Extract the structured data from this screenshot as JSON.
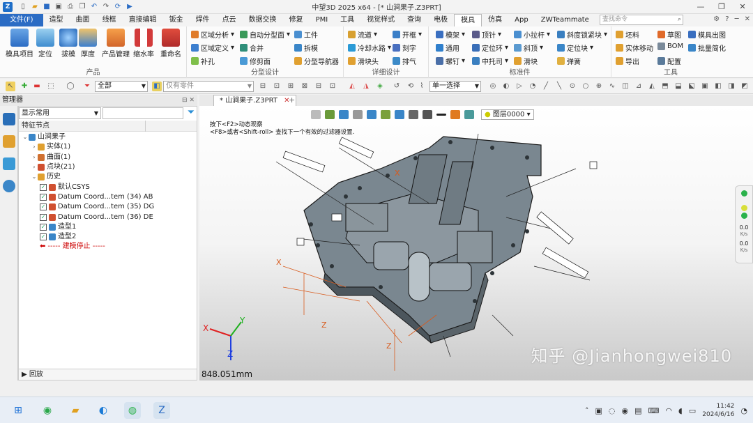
{
  "title_bar": {
    "title": "中望3D 2025 x64 - [* 山涧果子.Z3PRT]",
    "qat_icons": [
      "new-file-icon",
      "open-folder-icon",
      "save-icon",
      "save-all-icon",
      "print-icon",
      "copy-icon",
      "undo-icon",
      "redo-icon",
      "regen-icon",
      "play-icon"
    ]
  },
  "menu": {
    "file_label": "文件(F)",
    "tabs": [
      "造型",
      "曲面",
      "线框",
      "直接编辑",
      "钣金",
      "焊件",
      "点云",
      "数据交换",
      "修复",
      "PMI",
      "工具",
      "视觉样式",
      "查询",
      "电极",
      "模具",
      "仿真",
      "App",
      "ZWTeammate"
    ],
    "active_tab": "模具",
    "search_placeholder": "查找命令"
  },
  "ribbon": {
    "product": {
      "label": "产品",
      "buttons": [
        "模具项目",
        "定位",
        "拔模",
        "厚度",
        "产品管理",
        "缩水率",
        "重命名"
      ]
    },
    "parting": {
      "label": "分型设计",
      "buttons": [
        "区域分析",
        "自动分型面",
        "工件",
        "区域定义",
        "合并",
        "拆模",
        "补孔",
        "修剪面",
        "分型导航器"
      ]
    },
    "detail": {
      "label": "详细设计",
      "buttons": [
        "流道",
        "开框",
        "冷却水路",
        "刻字",
        "滑块头",
        "排气"
      ]
    },
    "standard": {
      "label": "标准件",
      "buttons": [
        "模架",
        "顶针",
        "小拉杆",
        "斜度锁紧块",
        "通用",
        "定位环",
        "斜顶",
        "定位块",
        "螺钉",
        "中托司",
        "滑块",
        "弹簧"
      ]
    },
    "tools": {
      "label": "工具",
      "buttons": [
        "坯料",
        "草图",
        "模具出图",
        "实体移动",
        "BOM",
        "批量简化",
        "导出",
        "配置"
      ]
    }
  },
  "toolbar": {
    "filter_all": "全部",
    "filter_parts": "仅有零件",
    "select_mode": "单一选择"
  },
  "manager": {
    "title": "管理器",
    "filter_value": "显示常用",
    "column_header": "特征节点",
    "tree": [
      {
        "label": "山涧果子",
        "indent": 0,
        "toggle": "⌄",
        "icon": "part"
      },
      {
        "label": "实体(1)",
        "indent": 1,
        "toggle": "›",
        "icon": "solid"
      },
      {
        "label": "曲面(1)",
        "indent": 1,
        "toggle": "›",
        "icon": "surface"
      },
      {
        "label": "点块(21)",
        "indent": 1,
        "toggle": "›",
        "icon": "point"
      },
      {
        "label": "历史",
        "indent": 1,
        "toggle": "⌄",
        "icon": "history"
      },
      {
        "label": "默认CSYS",
        "indent": 2,
        "check": true,
        "icon": "csys"
      },
      {
        "label": "Datum Coord...tem (34) AB",
        "indent": 2,
        "check": true,
        "icon": "csys"
      },
      {
        "label": "Datum Coord...tem (35) DG",
        "indent": 2,
        "check": true,
        "icon": "csys"
      },
      {
        "label": "Datum Coord...tem (36) DE",
        "indent": 2,
        "check": true,
        "icon": "csys"
      },
      {
        "label": "造型1",
        "indent": 2,
        "check": true,
        "icon": "shape"
      },
      {
        "label": "造型2",
        "indent": 2,
        "check": true,
        "icon": "shape"
      },
      {
        "label": "----- 建模停止 -----",
        "indent": 2,
        "stop": true
      }
    ],
    "footer": "回放"
  },
  "viewport": {
    "doc_tab": "* 山涧果子.Z3PRT",
    "layer": "图层0000",
    "hint_line1": "按下<F2>动态观察",
    "hint_line2": "<F8>或者<Shift-roll> 查找下一个有效的过滤器设置.",
    "distance": "848.051mm",
    "watermark": "知乎 @Jianhongwei810",
    "axis_labels": {
      "x": "X",
      "y": "Y",
      "z": "Z"
    }
  },
  "status_panel": {
    "value1": "0.0",
    "unit1": "K/s",
    "value2": "0.0",
    "unit2": "K/s",
    "colors": [
      "#2bb24c",
      "#d8df3a",
      "#2bb24c"
    ]
  },
  "taskbar": {
    "time": "11:42",
    "date": "2024/6/16",
    "apps": [
      "windows-start-icon",
      "browser-edge-icon",
      "file-explorer-icon",
      "edge-icon",
      "wechat-icon",
      "zw3d-app-icon"
    ]
  },
  "colors": {
    "accent": "#2b6cc4",
    "part_fill": "#7a8790",
    "part_edge": "#1a1a1a"
  }
}
